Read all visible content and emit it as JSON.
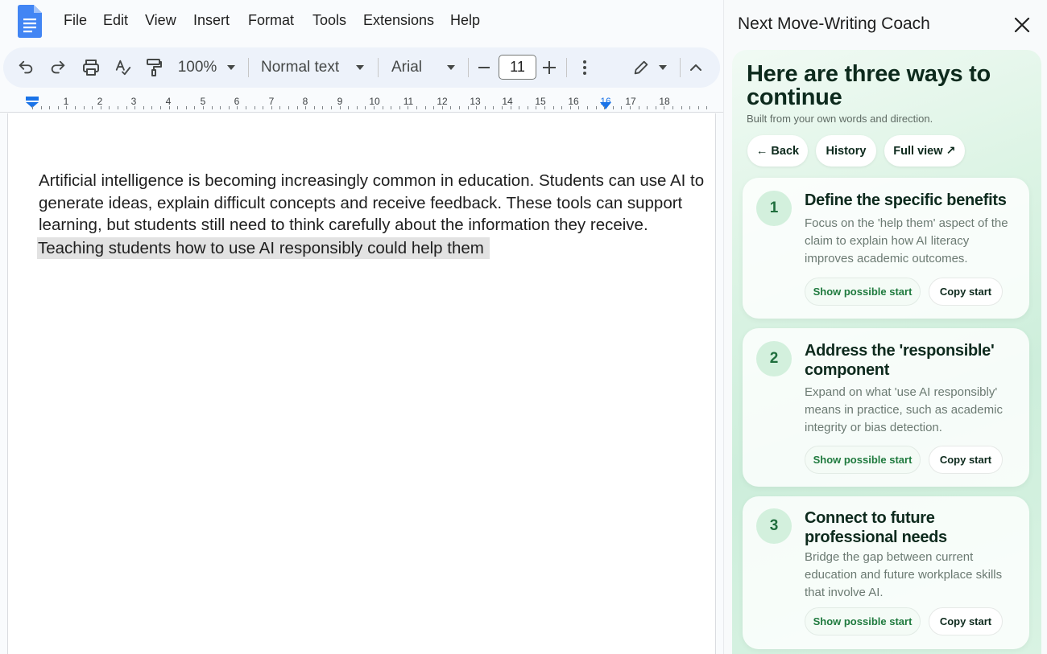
{
  "menu": {
    "items": [
      "File",
      "Edit",
      "View",
      "Insert",
      "Format",
      "Tools",
      "Extensions",
      "Help"
    ]
  },
  "toolbar": {
    "zoom": "100%",
    "style": "Normal text",
    "font": "Arial",
    "font_size": "11"
  },
  "ruler": {
    "numbers": [
      "1",
      "2",
      "3",
      "4",
      "5",
      "6",
      "7",
      "8",
      "9",
      "10",
      "11",
      "12",
      "13",
      "14",
      "15",
      "16",
      "16",
      "17",
      "18"
    ]
  },
  "document": {
    "lines": [
      "Artificial intelligence is becoming increasingly common in education. Students can use AI to",
      "generate ideas, explain difficult concepts and receive feedback. These tools can support",
      "learning, but students still need to think carefully about the information they receive."
    ],
    "selected_line": "Teaching students how to use AI responsibly could help them"
  },
  "panel": {
    "title": "Next Move-Writing Coach",
    "heading": "Here are three ways to continue",
    "subtitle": "Built from your own words and direction.",
    "back_label": "← Back",
    "history_label": "History",
    "fullview_label": "Full view ↗",
    "cards": [
      {
        "number": "1",
        "title": "Define the specific benefits",
        "description": "Focus on the 'help them' aspect of the claim to explain how AI literacy improves academic outcomes.",
        "show_label": "Show possible start",
        "copy_label": "Copy start"
      },
      {
        "number": "2",
        "title": "Address the 'responsible' component",
        "description": "Expand on what 'use AI responsibly' means in practice, such as academic integrity or bias detection.",
        "show_label": "Show possible start",
        "copy_label": "Copy start"
      },
      {
        "number": "3",
        "title": "Connect to future professional needs",
        "description": "Bridge the gap between current education and future workplace skills that involve AI.",
        "show_label": "Show possible start",
        "copy_label": "Copy start"
      }
    ]
  },
  "colors": {
    "accent_green": "#1f7a3e",
    "docs_blue": "#4285f4",
    "toolbar_bg": "#edf2fa"
  },
  "icons": [
    "docs-logo-icon",
    "undo-icon",
    "redo-icon",
    "print-icon",
    "spellcheck-icon",
    "paint-format-icon",
    "dropdown-icon",
    "minus-icon",
    "plus-icon",
    "more-vert-icon",
    "edit-pencil-icon",
    "collapse-icon",
    "close-icon"
  ]
}
